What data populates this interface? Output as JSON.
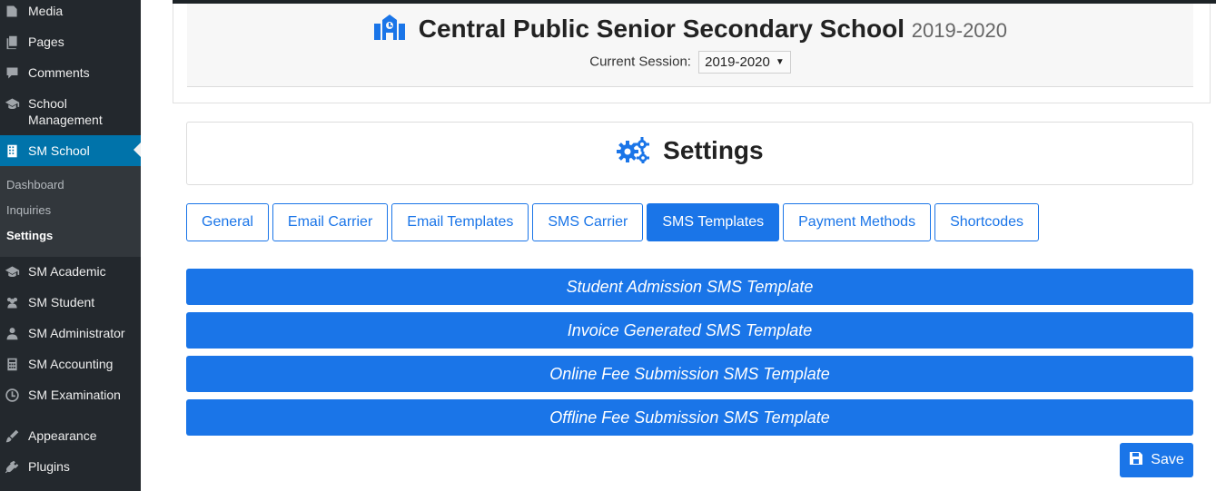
{
  "sidebar": {
    "items": [
      {
        "label": "Media",
        "icon": "media-icon"
      },
      {
        "label": "Pages",
        "icon": "pages-icon"
      },
      {
        "label": "Comments",
        "icon": "comments-icon"
      },
      {
        "label": "School Management",
        "icon": "graduation-cap-icon"
      },
      {
        "label": "SM School",
        "icon": "building-icon"
      },
      {
        "label": "SM Academic",
        "icon": "graduation-cap-icon"
      },
      {
        "label": "SM Student",
        "icon": "users-icon"
      },
      {
        "label": "SM Administrator",
        "icon": "user-icon"
      },
      {
        "label": "SM Accounting",
        "icon": "calculator-icon"
      },
      {
        "label": "SM Examination",
        "icon": "clock-icon"
      },
      {
        "label": "Appearance",
        "icon": "brush-icon"
      },
      {
        "label": "Plugins",
        "icon": "plug-icon"
      }
    ],
    "submenu": [
      "Dashboard",
      "Inquiries",
      "Settings"
    ],
    "active_color": "#0073aa"
  },
  "header": {
    "school_name": "Central Public Senior Secondary School",
    "year": "2019-2020",
    "session_label": "Current Session:",
    "session_value": "2019-2020"
  },
  "settings": {
    "title": "Settings",
    "tabs": [
      "General",
      "Email Carrier",
      "Email Templates",
      "SMS Carrier",
      "SMS Templates",
      "Payment Methods",
      "Shortcodes"
    ],
    "active_tab": "SMS Templates",
    "panels": [
      "Student Admission SMS Template",
      "Invoice Generated SMS Template",
      "Online Fee Submission SMS Template",
      "Offline Fee Submission SMS Template"
    ],
    "save_label": "Save",
    "accent_color": "#1a75e8"
  }
}
